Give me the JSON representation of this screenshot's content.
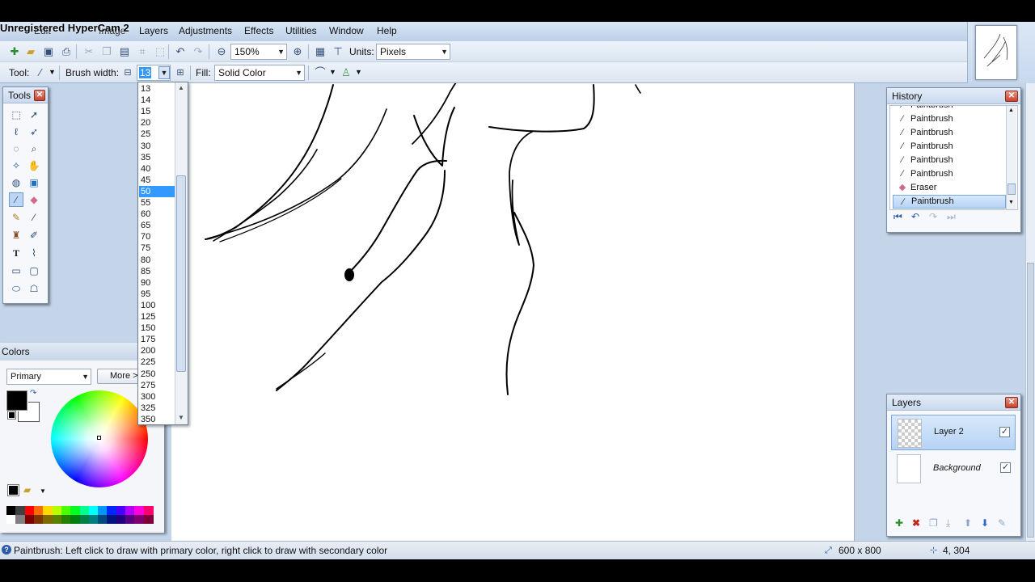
{
  "watermark": "Unregistered HyperCam 2",
  "menu": [
    "Layers",
    "Adjustments",
    "Effects",
    "Utilities",
    "Window",
    "Help"
  ],
  "toolbar": {
    "zoom_value": "150%",
    "units_label": "Units:",
    "units_value": "Pixels",
    "tool_label": "Tool:",
    "brush_width_label": "Brush width:",
    "brush_width_value": "13",
    "fill_label": "Fill:",
    "fill_value": "Solid Color"
  },
  "brush_width_options": [
    "13",
    "14",
    "15",
    "20",
    "25",
    "30",
    "35",
    "40",
    "45",
    "50",
    "55",
    "60",
    "65",
    "70",
    "75",
    "80",
    "85",
    "90",
    "95",
    "100",
    "125",
    "150",
    "175",
    "200",
    "225",
    "250",
    "275",
    "300",
    "325",
    "350"
  ],
  "brush_width_highlighted": "50",
  "tools_panel": {
    "title": "Tools",
    "icons": [
      "rectangle-select-icon",
      "move-selection-icon",
      "lasso-icon",
      "move-icon",
      "ellipse-select-icon",
      "zoom-icon",
      "magic-wand-icon",
      "pan-icon",
      "paint-bucket-icon",
      "gradient-icon",
      "paintbrush-icon",
      "eraser-icon",
      "pencil-icon",
      "color-picker-icon",
      "clone-stamp-icon",
      "recolor-icon",
      "text-icon",
      "line-curve-icon",
      "rectangle-icon",
      "rounded-rectangle-icon",
      "ellipse-icon",
      "freeform-shape-icon"
    ]
  },
  "colors_panel": {
    "title": "Colors",
    "mode": "Primary",
    "more_button": "More >>",
    "primary_color": "#000000",
    "secondary_color": "#ffffff",
    "palette_top": [
      "#000000",
      "#404040",
      "#ff0000",
      "#ff6a00",
      "#ffd800",
      "#b6ff00",
      "#4cff00",
      "#00ff21",
      "#00ff90",
      "#00ffff",
      "#0094ff",
      "#0026ff",
      "#4800ff",
      "#b200ff",
      "#ff00dc",
      "#ff006e"
    ],
    "palette_bottom": [
      "#ffffff",
      "#808080",
      "#7f0000",
      "#7f3300",
      "#7f6a00",
      "#5b7f00",
      "#267f00",
      "#007f0e",
      "#007f46",
      "#007f7f",
      "#004a7f",
      "#00137f",
      "#21007f",
      "#57007f",
      "#7f006e",
      "#7f0037"
    ]
  },
  "history_panel": {
    "title": "History",
    "items": [
      {
        "label": "Paintbrush",
        "icon": "paintbrush-icon"
      },
      {
        "label": "Paintbrush",
        "icon": "paintbrush-icon"
      },
      {
        "label": "Paintbrush",
        "icon": "paintbrush-icon"
      },
      {
        "label": "Paintbrush",
        "icon": "paintbrush-icon"
      },
      {
        "label": "Paintbrush",
        "icon": "paintbrush-icon"
      },
      {
        "label": "Paintbrush",
        "icon": "paintbrush-icon"
      },
      {
        "label": "Eraser",
        "icon": "eraser-icon"
      },
      {
        "label": "Paintbrush",
        "icon": "paintbrush-icon"
      }
    ],
    "selected_index": 7
  },
  "layers_panel": {
    "title": "Layers",
    "layers": [
      {
        "name": "Layer 2",
        "visible": true,
        "selected": true
      },
      {
        "name": "Background",
        "visible": true,
        "selected": false
      }
    ]
  },
  "status": {
    "message": "Paintbrush: Left click to draw with primary color, right click to draw with secondary color",
    "image_size": "600 x 800",
    "cursor_position": "4, 304"
  }
}
